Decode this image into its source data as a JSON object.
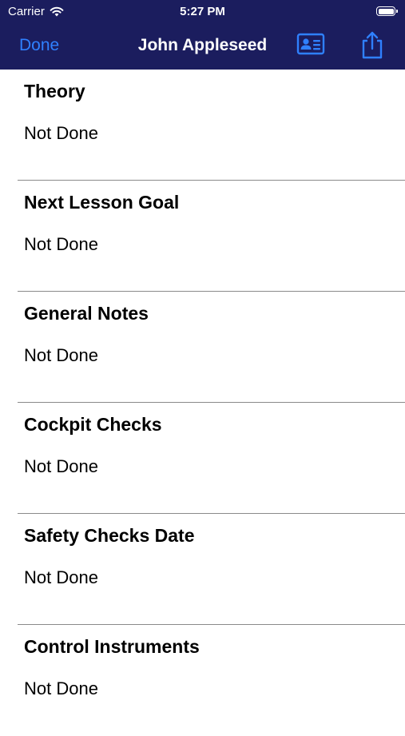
{
  "status_bar": {
    "carrier": "Carrier",
    "time": "5:27 PM",
    "icons": [
      "wifi-icon",
      "battery-icon"
    ]
  },
  "nav": {
    "done_label": "Done",
    "title": "John Appleseed",
    "icons": [
      "contact-card-icon",
      "share-icon"
    ]
  },
  "colors": {
    "nav_background": "#1b1d5e",
    "accent": "#2f80ff",
    "divider": "#8a8a8a"
  },
  "sections": [
    {
      "title": "Theory",
      "value": "Not Done"
    },
    {
      "title": "Next Lesson Goal",
      "value": "Not Done"
    },
    {
      "title": "General Notes",
      "value": "Not Done"
    },
    {
      "title": "Cockpit Checks",
      "value": "Not Done"
    },
    {
      "title": "Safety Checks Date",
      "value": "Not Done"
    },
    {
      "title": "Control Instruments",
      "value": "Not Done"
    }
  ]
}
